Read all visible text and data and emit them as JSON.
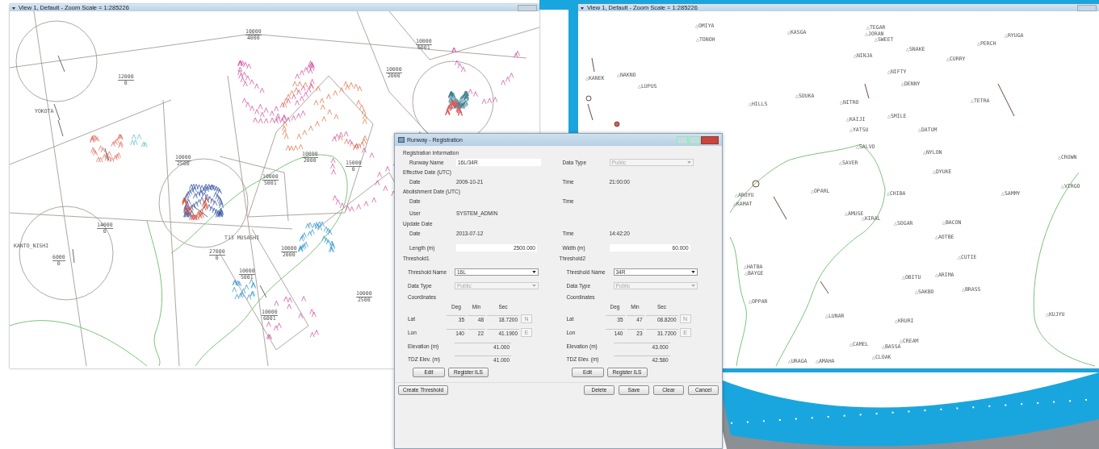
{
  "left_window": {
    "title": "View 1, Default - Zoom Scale = 1:285226",
    "altitude_labels": [
      {
        "upper": "10000",
        "lower": "4000"
      },
      {
        "upper": "12000",
        "lower": "0"
      },
      {
        "upper": "10000",
        "lower": "2500"
      },
      {
        "upper": "10000",
        "lower": "2000"
      },
      {
        "upper": "15000",
        "lower": "0"
      },
      {
        "upper": "10000",
        "lower": "5001"
      },
      {
        "upper": "14000",
        "lower": "0"
      },
      {
        "upper": "6000",
        "lower": "0"
      },
      {
        "upper": "10000",
        "lower": "2000"
      },
      {
        "upper": "10000",
        "lower": "5001"
      },
      {
        "upper": "10000",
        "lower": "6001"
      },
      {
        "upper": "10000",
        "lower": "2500"
      },
      {
        "upper": "10000",
        "lower": "2000"
      },
      {
        "upper": "10000",
        "lower": "6001"
      },
      {
        "upper": "27000",
        "lower": "0"
      }
    ],
    "place_labels": [
      "YOKOTA",
      "T13 MUSASHI",
      "KANTO_NISHI"
    ]
  },
  "right_window": {
    "title": "View 1, Default - Zoom Scale = 1:285226",
    "waypoints": [
      "△OMIYA",
      "△TONOH",
      "△KASGA",
      "△TEGAR",
      "△JORAN",
      "△SWEET",
      "△SNAKE",
      "△PERCH",
      "△RYUGA",
      "△CURRY",
      "△NINJA",
      "△NIFTY",
      "△DENNY",
      "△KANEK",
      "△NAKNO",
      "△LUPUS",
      "△HILLS",
      "△SOUKA",
      "△NITRO",
      "△TETRA",
      "△KAIJI",
      "△SMILE",
      "△YATSU",
      "△DATUM",
      "△SALVO",
      "△SAVER",
      "△NYLON",
      "△CROWN",
      "△DYUKE",
      "△OPARL",
      "△CHIBA",
      "△SAMMY",
      "△VIRGO",
      "△AROYU",
      "△KAMAT",
      "△AMUSE",
      "△KIRAL",
      "△SOGAR",
      "△BACON",
      "△AOTBE",
      "△CUTIE",
      "△HATBA",
      "△BAYGE",
      "△OBITU",
      "△ARIMA",
      "△SAKBO",
      "△BRASS",
      "△OPPAR",
      "△LUNAR",
      "△KRURI",
      "△KUJYU",
      "△CAMEL",
      "△CREAM",
      "△BASSA",
      "△CLOAK",
      "△URAGA",
      "△AMAHA"
    ]
  },
  "dialog": {
    "title": "Runway - Registration",
    "section": "Registration Information",
    "runway_name": {
      "label": "Runway Name",
      "value": "16L/34R"
    },
    "data_type": {
      "label": "Data Type",
      "value": "Public",
      "disabled": true
    },
    "effective_date": {
      "heading": "Effective Date (UTC)",
      "date_label": "Date",
      "date": "2009-10-21",
      "time_label": "Time",
      "time": "21:00:00"
    },
    "abolishment_date": {
      "heading": "Abolishment Date (UTC)",
      "date_label": "Date",
      "time_label": "Time"
    },
    "user": {
      "label": "User",
      "value": "SYSTEM_ADMIN"
    },
    "update_date": {
      "heading": "Update Date",
      "date_label": "Date",
      "date": "2013-07-12",
      "time_label": "Time",
      "time": "14:42:20"
    },
    "length": {
      "label": "Length (m)",
      "value": "2500.000"
    },
    "width": {
      "label": "Width (m)",
      "value": "60.000"
    },
    "thresholds": [
      {
        "heading": "Threshold1",
        "name_label": "Threshold Name",
        "name": "16L",
        "data_type_label": "Data Type",
        "data_type": "Public",
        "data_type_disabled": true,
        "coordinates_label": "Coordinates",
        "columns": [
          "Deg",
          "Min",
          "Sec"
        ],
        "lat": {
          "label": "Lat",
          "deg": "35",
          "min": "48",
          "sec": "18.7200",
          "hemisphere": "N"
        },
        "lon": {
          "label": "Lon",
          "deg": "140",
          "min": "22",
          "sec": "41.1900",
          "hemisphere": "E"
        },
        "elevation": {
          "label": "Elevation (m)",
          "value": "41.000"
        },
        "tdz": {
          "label": "TDZ Elev. (m)",
          "value": "41.000"
        },
        "buttons": [
          "Edit",
          "Register ILS"
        ]
      },
      {
        "heading": "Threshold2",
        "name_label": "Threshold Name",
        "name": "34R",
        "data_type_label": "Data Type",
        "data_type": "Public",
        "data_type_disabled": true,
        "coordinates_label": "Coordinates",
        "columns": [
          "Deg",
          "Min",
          "Sec"
        ],
        "lat": {
          "label": "Lat",
          "deg": "35",
          "min": "47",
          "sec": "08.8200",
          "hemisphere": "N"
        },
        "lon": {
          "label": "Lon",
          "deg": "140",
          "min": "23",
          "sec": "31.7200",
          "hemisphere": "E"
        },
        "elevation": {
          "label": "Elevation (m)",
          "value": "43.000"
        },
        "tdz": {
          "label": "TDZ Elev. (m)",
          "value": "42.580"
        },
        "buttons": [
          "Edit",
          "Register ILS"
        ]
      }
    ],
    "footer_left": "Create Threshold",
    "footer_buttons": [
      "Delete",
      "Save",
      "Clear",
      "Cancel"
    ]
  }
}
